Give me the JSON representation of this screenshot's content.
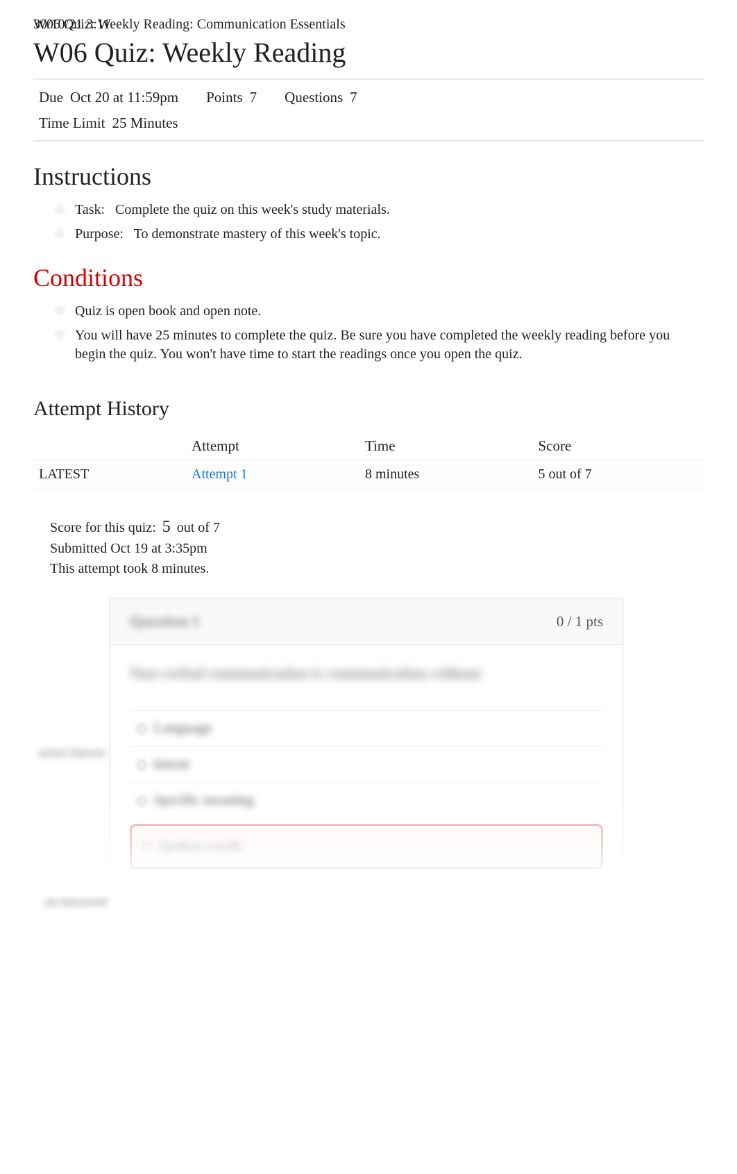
{
  "header": {
    "timestamp": "30/10/21 3:11",
    "doc_title": "W06 Quiz: Weekly Reading: Communication Essentials"
  },
  "page_title": "W06 Quiz: Weekly Reading",
  "meta": {
    "due_label": "Due",
    "due_value": "Oct 20 at 11:59pm",
    "points_label": "Points",
    "points_value": "7",
    "questions_label": "Questions",
    "questions_value": "7",
    "time_limit_label": "Time Limit",
    "time_limit_value": "25 Minutes"
  },
  "instructions": {
    "heading": "Instructions",
    "items": [
      {
        "prefix": "Task:",
        "text": "Complete the quiz on this week's study materials."
      },
      {
        "prefix": "Purpose:",
        "text": "To demonstrate mastery of this week's topic."
      }
    ]
  },
  "conditions": {
    "heading": "Conditions",
    "items": [
      {
        "text": "Quiz is open book and open note."
      },
      {
        "text": "You will have 25 minutes to complete the quiz. Be sure you have completed the weekly reading before you begin the quiz. You won't have time to start the readings once you open the quiz."
      }
    ]
  },
  "attempt_history": {
    "heading": "Attempt History",
    "columns": [
      "",
      "Attempt",
      "Time",
      "Score"
    ],
    "rows": [
      {
        "status": "LATEST",
        "attempt": "Attempt 1",
        "time": "8 minutes",
        "score": "5 out of 7"
      }
    ]
  },
  "score_summary": {
    "prefix": "Score for this quiz:",
    "score": "5",
    "suffix": "out of 7",
    "submitted": "Submitted Oct 19 at 3:35pm",
    "duration": "This attempt took 8 minutes."
  },
  "question1": {
    "title": "Question 1",
    "points": "0 / 1 pts",
    "text": "Non-verbal communication is communication without",
    "answers": [
      "Language",
      "Intent",
      "Specific meaning",
      "Spoken words"
    ],
    "side_correct": "orrect Answer",
    "side_answered": "ou Answered"
  }
}
